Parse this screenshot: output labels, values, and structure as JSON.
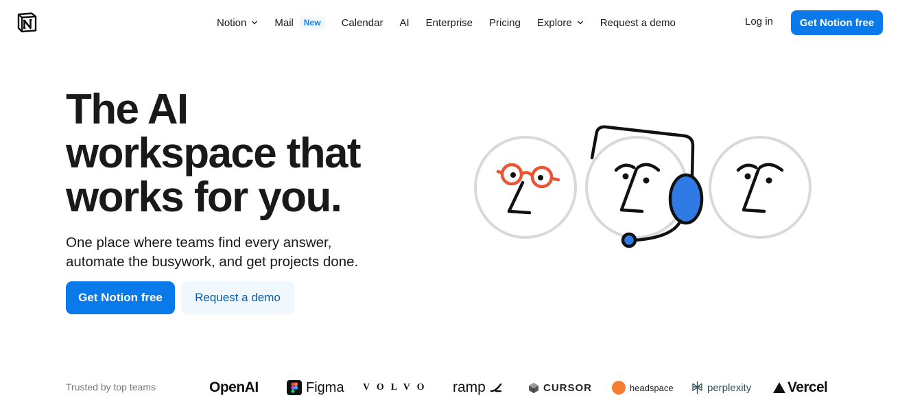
{
  "brand": {
    "logo_icon": "notion-logo-icon",
    "accent": "#0a7aeb"
  },
  "nav": {
    "items": [
      {
        "label": "Notion",
        "has_dropdown": true
      },
      {
        "label": "Mail",
        "badge": "New"
      },
      {
        "label": "Calendar"
      },
      {
        "label": "AI"
      },
      {
        "label": "Enterprise"
      },
      {
        "label": "Pricing"
      },
      {
        "label": "Explore",
        "has_dropdown": true
      },
      {
        "label": "Request a demo"
      }
    ],
    "login": "Log in",
    "cta": "Get Notion free"
  },
  "hero": {
    "title_lines": [
      "The AI",
      "workspace that",
      "works for you."
    ],
    "subtitle_lines": [
      "One place where teams find every answer,",
      "automate the busywork, and get projects done."
    ],
    "primary_cta": "Get Notion free",
    "secondary_cta": "Request a demo",
    "illustration": {
      "icons": [
        "face-with-glasses-icon",
        "face-with-headset-icon",
        "face-icon"
      ],
      "colors": {
        "glasses": "#eb5533",
        "headset": "#2f7ae5",
        "circle": "#d9d9d9"
      }
    }
  },
  "trusted": {
    "label": "Trusted by top teams",
    "logos": [
      "OpenAI",
      "Figma",
      "VOLVO",
      "ramp",
      "CURSOR",
      "headspace",
      "perplexity",
      "Vercel"
    ]
  }
}
